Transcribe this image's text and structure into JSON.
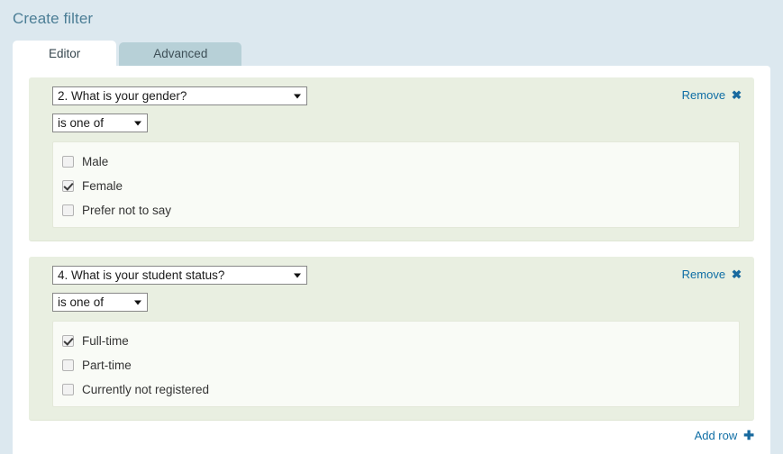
{
  "page": {
    "title": "Create filter",
    "background_color": "#dce8ef",
    "title_color": "#4c7e96"
  },
  "tabs": [
    {
      "label": "Editor",
      "active": true
    },
    {
      "label": "Advanced",
      "active": false
    }
  ],
  "colors": {
    "accent_link": "#0f6ea5",
    "row_background": "#e9efe1",
    "options_background": "#f9fbf6",
    "inactive_tab": "#b7d0d7"
  },
  "filter_rows": [
    {
      "remove_label": "Remove",
      "remove_icon": "close-x-icon",
      "question": "2. What is your gender?",
      "operator": "is one of",
      "options": [
        {
          "label": "Male",
          "checked": false
        },
        {
          "label": "Female",
          "checked": true
        },
        {
          "label": "Prefer not to say",
          "checked": false
        }
      ]
    },
    {
      "remove_label": "Remove",
      "remove_icon": "close-x-icon",
      "question": "4. What is your student status?",
      "operator": "is one of",
      "options": [
        {
          "label": "Full-time",
          "checked": true
        },
        {
          "label": "Part-time",
          "checked": false
        },
        {
          "label": "Currently not registered",
          "checked": false
        }
      ]
    }
  ],
  "footer": {
    "add_row_label": "Add row",
    "add_row_icon": "plus-icon"
  },
  "glyphs": {
    "x": "✖",
    "plus": "✚"
  }
}
